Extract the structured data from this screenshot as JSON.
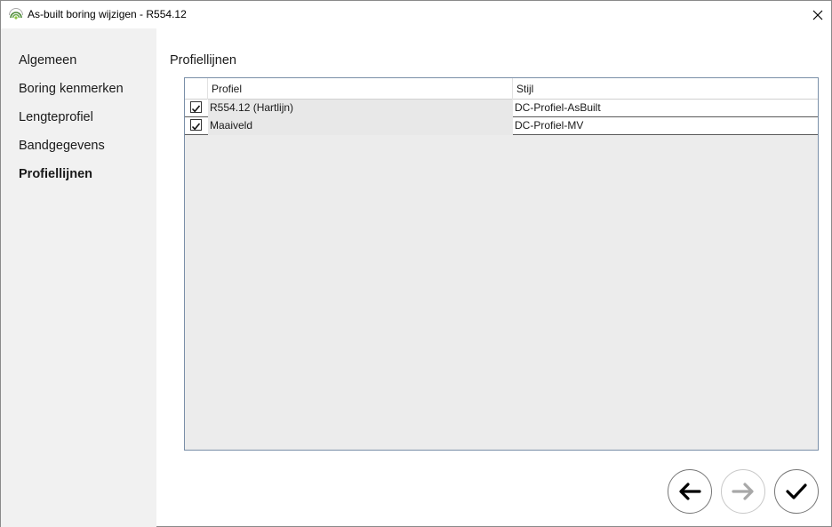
{
  "window": {
    "title": "As-built boring wijzigen - R554.12"
  },
  "sidebar": {
    "items": [
      {
        "label": "Algemeen",
        "active": false
      },
      {
        "label": "Boring kenmerken",
        "active": false
      },
      {
        "label": "Lengteprofiel",
        "active": false
      },
      {
        "label": "Bandgegevens",
        "active": false
      },
      {
        "label": "Profiellijnen",
        "active": true
      }
    ]
  },
  "main": {
    "section_title": "Profiellijnen",
    "grid": {
      "columns": [
        "Profiel",
        "Stijl"
      ],
      "rows": [
        {
          "checked": true,
          "profiel": "R554.12 (Hartlijn)",
          "stijl": "DC-Profiel-AsBuilt"
        },
        {
          "checked": true,
          "profiel": "Maaiveld",
          "stijl": "DC-Profiel-MV"
        }
      ]
    }
  },
  "footer": {
    "back_icon": "arrow-left-icon",
    "next_icon": "arrow-right-icon",
    "finish_icon": "checkmark-icon"
  },
  "colors": {
    "sidebar_bg": "#f1f1f1",
    "grid_border": "#7a8fa8",
    "grid_empty_bg": "#ececec"
  }
}
